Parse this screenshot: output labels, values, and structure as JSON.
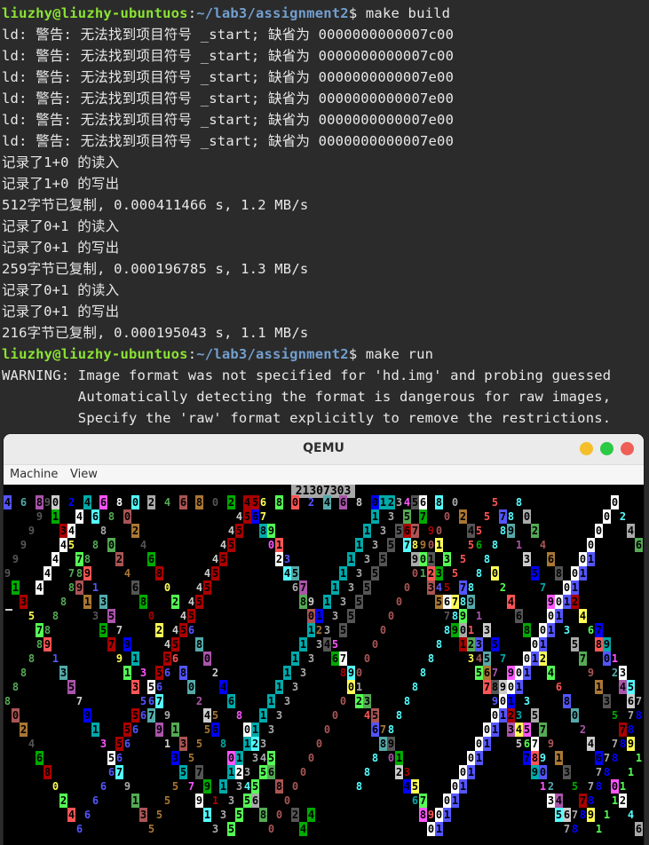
{
  "terminal": {
    "prompt1": {
      "user": "liuzhy@liuzhy-ubuntuos",
      "sep": ":",
      "path": "~/lab3/assignment2",
      "cmd": "$ make build"
    },
    "lines": [
      "ld: 警告: 无法找到项目符号 _start; 缺省为 0000000000007c00",
      "ld: 警告: 无法找到项目符号 _start; 缺省为 0000000000007c00",
      "ld: 警告: 无法找到项目符号 _start; 缺省为 0000000000007e00",
      "ld: 警告: 无法找到项目符号 _start; 缺省为 0000000000007e00",
      "ld: 警告: 无法找到项目符号 _start; 缺省为 0000000000007e00",
      "ld: 警告: 无法找到项目符号 _start; 缺省为 0000000000007e00",
      "记录了1+0 的读入",
      "记录了1+0 的写出",
      "512字节已复制, 0.000411466 s, 1.2 MB/s",
      "记录了0+1 的读入",
      "记录了0+1 的写出",
      "259字节已复制, 0.000196785 s, 1.3 MB/s",
      "记录了0+1 的读入",
      "记录了0+1 的写出",
      "216字节已复制, 0.000195043 s, 1.1 MB/s"
    ],
    "prompt2": {
      "user": "liuzhy@liuzhy-ubuntuos",
      "sep": ":",
      "path": "~/lab3/assignment2",
      "cmd": "$ make run"
    },
    "warning_lines": [
      "WARNING: Image format was not specified for 'hd.img' and probing guessed",
      "         Automatically detecting the format is dangerous for raw images,",
      "         Specify the 'raw' format explicitly to remove the restrictions."
    ]
  },
  "qemu": {
    "title": "QEMU",
    "menu": [
      "Machine",
      "View"
    ],
    "buttons": {
      "minimize": "#f5bf2a",
      "maximize": "#2aca44",
      "close": "#ef5f57"
    },
    "counter": "21307303"
  },
  "colors": [
    "#aaaaaa",
    "#5555ff",
    "#55aa55",
    "#55aaaa",
    "#aa5555",
    "#aa55aa",
    "#aa7733",
    "#cccccc",
    "#555555",
    "#0000ff",
    "#00aa00",
    "#00aaaa",
    "#aa0000",
    "#ff55ff",
    "#ffff55",
    "#ffffff",
    "#55ff55",
    "#55ffff",
    "#ff5555"
  ],
  "screen_glyphs": {
    "diamond_digits": [
      "3",
      "4",
      "5",
      "6",
      "7",
      "8",
      "9",
      "0",
      "1",
      "2"
    ]
  }
}
